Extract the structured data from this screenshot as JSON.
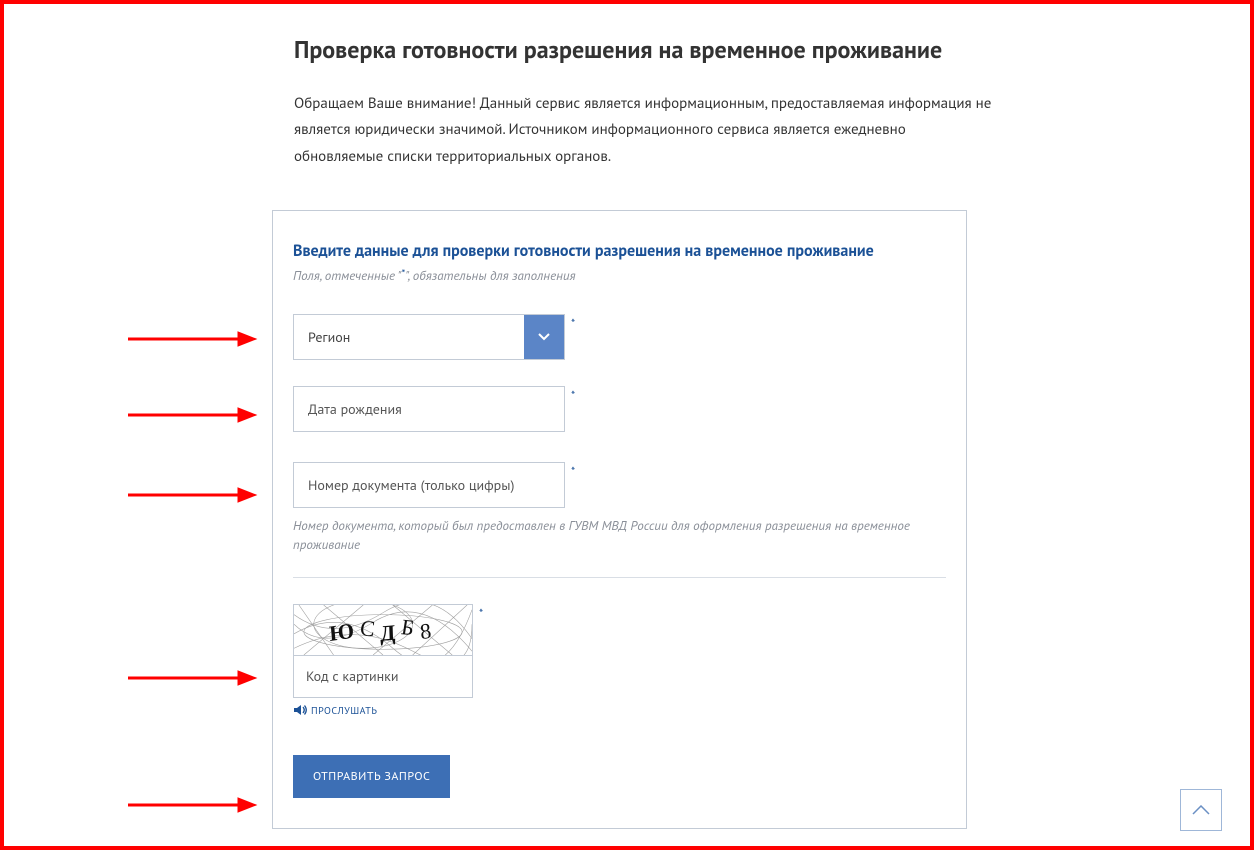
{
  "page": {
    "title": "Проверка готовности разрешения на временное проживание",
    "intro": "Обращаем Ваше внимание! Данный сервис является информационным, предоставляемая информация не является юридически значимой. Источником информационного сервиса является ежедневно обновляемые списки территориальных органов."
  },
  "form": {
    "title": "Введите данные для проверки готовности разрешения на временное проживание",
    "required_note_before": "Поля, отмеченные \"",
    "required_note_after": "\", обязательны для заполнения",
    "asterisk": "*",
    "region_placeholder": "Регион",
    "dob_placeholder": "Дата рождения",
    "doc_placeholder": "Номер документа (только цифры)",
    "doc_hint": "Номер документа, который был предоставлен в ГУВМ МВД России для оформления разрешения на временное проживание",
    "captcha_value": "ЮСДБ8",
    "captcha_placeholder": "Код с картинки",
    "listen_label": "ПРОСЛУШАТЬ",
    "submit_label": "ОТПРАВИТЬ ЗАПРОС"
  },
  "colors": {
    "accent": "#1b5196",
    "button_bg": "#3d6fb5",
    "border": "#c3cbd6",
    "arrow": "#ff0000"
  }
}
